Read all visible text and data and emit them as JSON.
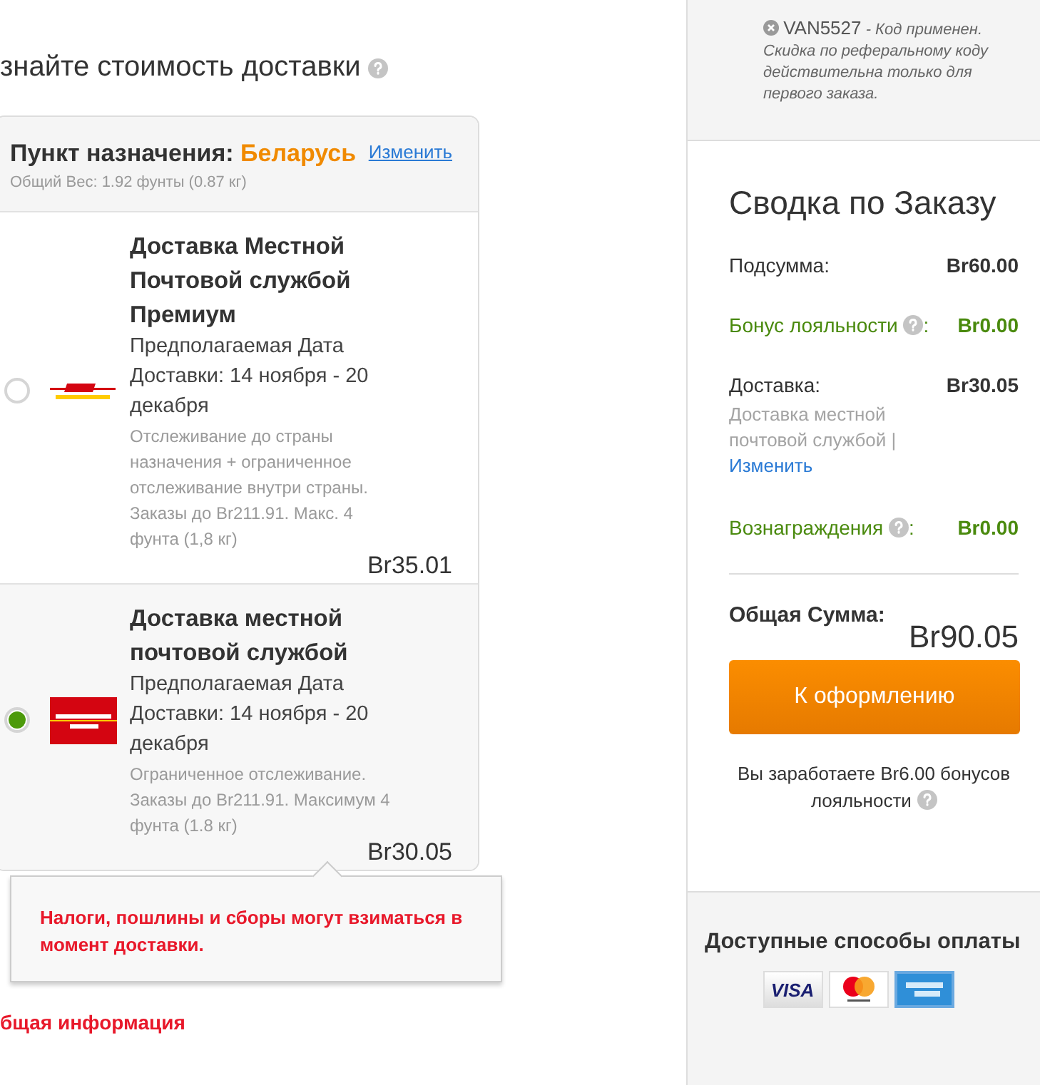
{
  "heading": "знайте стоимость доставки",
  "destination": {
    "label": "Пункт назначения:",
    "country": "Беларусь",
    "change_link": "Изменить",
    "weight": "Общий Вес: 1.92 фунты (0.87 кг)"
  },
  "shipping_options": [
    {
      "title": "Доставка Местной Почтовой службой Премиум",
      "estimate": "Предполагаемая Дата Доставки: 14 ноября - 20 декабря",
      "details": "Отслеживание до страны назначения + ограниченное отслеживание внутри страны. Заказы до Br211.91. Макс. 4 фунта (1,8 кг)",
      "price": "Br35.01",
      "selected": false,
      "kind": "stripe"
    },
    {
      "title": "Доставка местной почтовой службой",
      "estimate": "Предполагаемая Дата Доставки: 14 ноября - 20 декабря",
      "details": "Ограниченное отслеживание. Заказы до Br211.91. Максимум 4 фунта (1.8 кг)",
      "price": "Br30.05",
      "selected": true,
      "kind": "badge"
    }
  ],
  "tooltip": {
    "text": "Налоги, пошлины и сборы могут взиматься в момент доставки."
  },
  "general_info": {
    "title": "бщая информация"
  },
  "promo": {
    "code": "VAN5527",
    "status": "- Код применен.",
    "note": "Скидка по реферальному коду действительна только для первого заказа."
  },
  "summary": {
    "title": "Сводка по Заказу",
    "rows": [
      {
        "kind": "plain",
        "label": "Подсумма:",
        "value": "Br60.00"
      },
      {
        "kind": "bonus",
        "label": "Бонус лояльности",
        "suffix": ":",
        "value": "Br0.00"
      },
      {
        "kind": "shipping",
        "label": "Доставка:",
        "value": "Br30.05",
        "note": "Доставка местной почтовой службой |",
        "link": "Изменить"
      },
      {
        "kind": "bonus",
        "label": "Вознаграждения",
        "suffix": ":",
        "value": "Br0.00"
      }
    ],
    "total_label": "Общая Сумма:",
    "total": "Br90.05",
    "checkout_button": "К оформлению",
    "earn_note": [
      "Вы заработаете Br6.00 бонусов",
      "лояльности"
    ]
  },
  "payment": {
    "title": "Доступные способы оплаты",
    "cards": [
      {
        "kind": "visa",
        "label": "VISA"
      },
      {
        "kind": "circles"
      },
      {
        "kind": "blue"
      }
    ]
  }
}
